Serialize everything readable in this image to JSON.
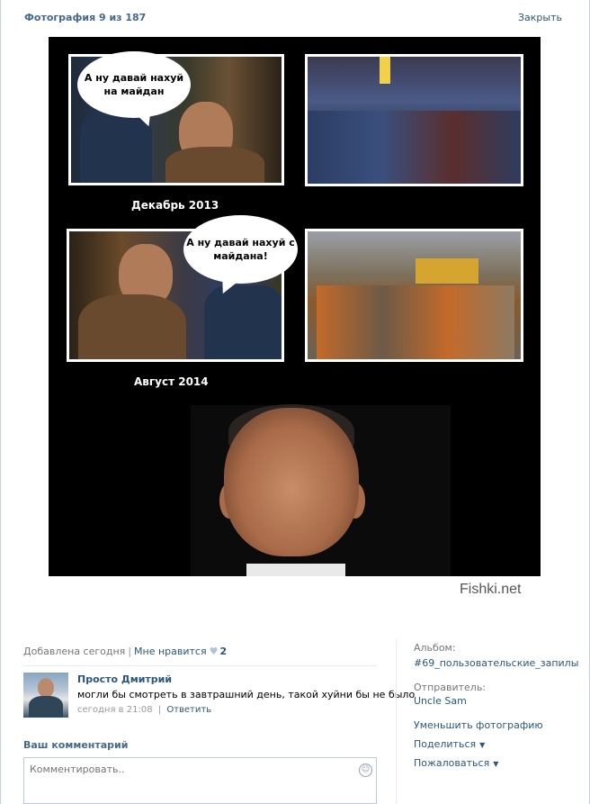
{
  "header": {
    "title": "Фотография 9 из 187",
    "close_label": "Закрыть"
  },
  "photo": {
    "bubble_top": "А ну давай нахуй на майдан",
    "bubble_bottom": "А ну давай нахуй с майдана!",
    "caption_top": "Декабрь 2013",
    "caption_bottom": "Август 2014",
    "watermark": "Fishki.net"
  },
  "info": {
    "added": "Добавлена сегодня",
    "separator": "|",
    "like_label": "Мне нравится",
    "like_icon": "heart-icon",
    "like_count": "2"
  },
  "comment": {
    "author": "Просто Дмитрий",
    "text": "могли бы смотреть в завтрашний день, такой хуйни бы не было",
    "time": "сегодня в 21:08",
    "separator": "|",
    "reply_label": "Ответить"
  },
  "compose": {
    "heading": "Ваш комментарий",
    "placeholder": "Комментировать..",
    "emoji_icon": "smile-icon"
  },
  "sidebar": {
    "album_label": "Альбом:",
    "album_name": "#69_пользовательские_запилы",
    "sender_label": "Отправитель:",
    "sender_name": "Uncle Sam",
    "shrink_label": "Уменьшить фотографию",
    "share_label": "Поделиться",
    "report_label": "Пожаловаться"
  },
  "colors": {
    "link": "#2b587a",
    "heading": "#45688e",
    "muted": "#777777"
  }
}
